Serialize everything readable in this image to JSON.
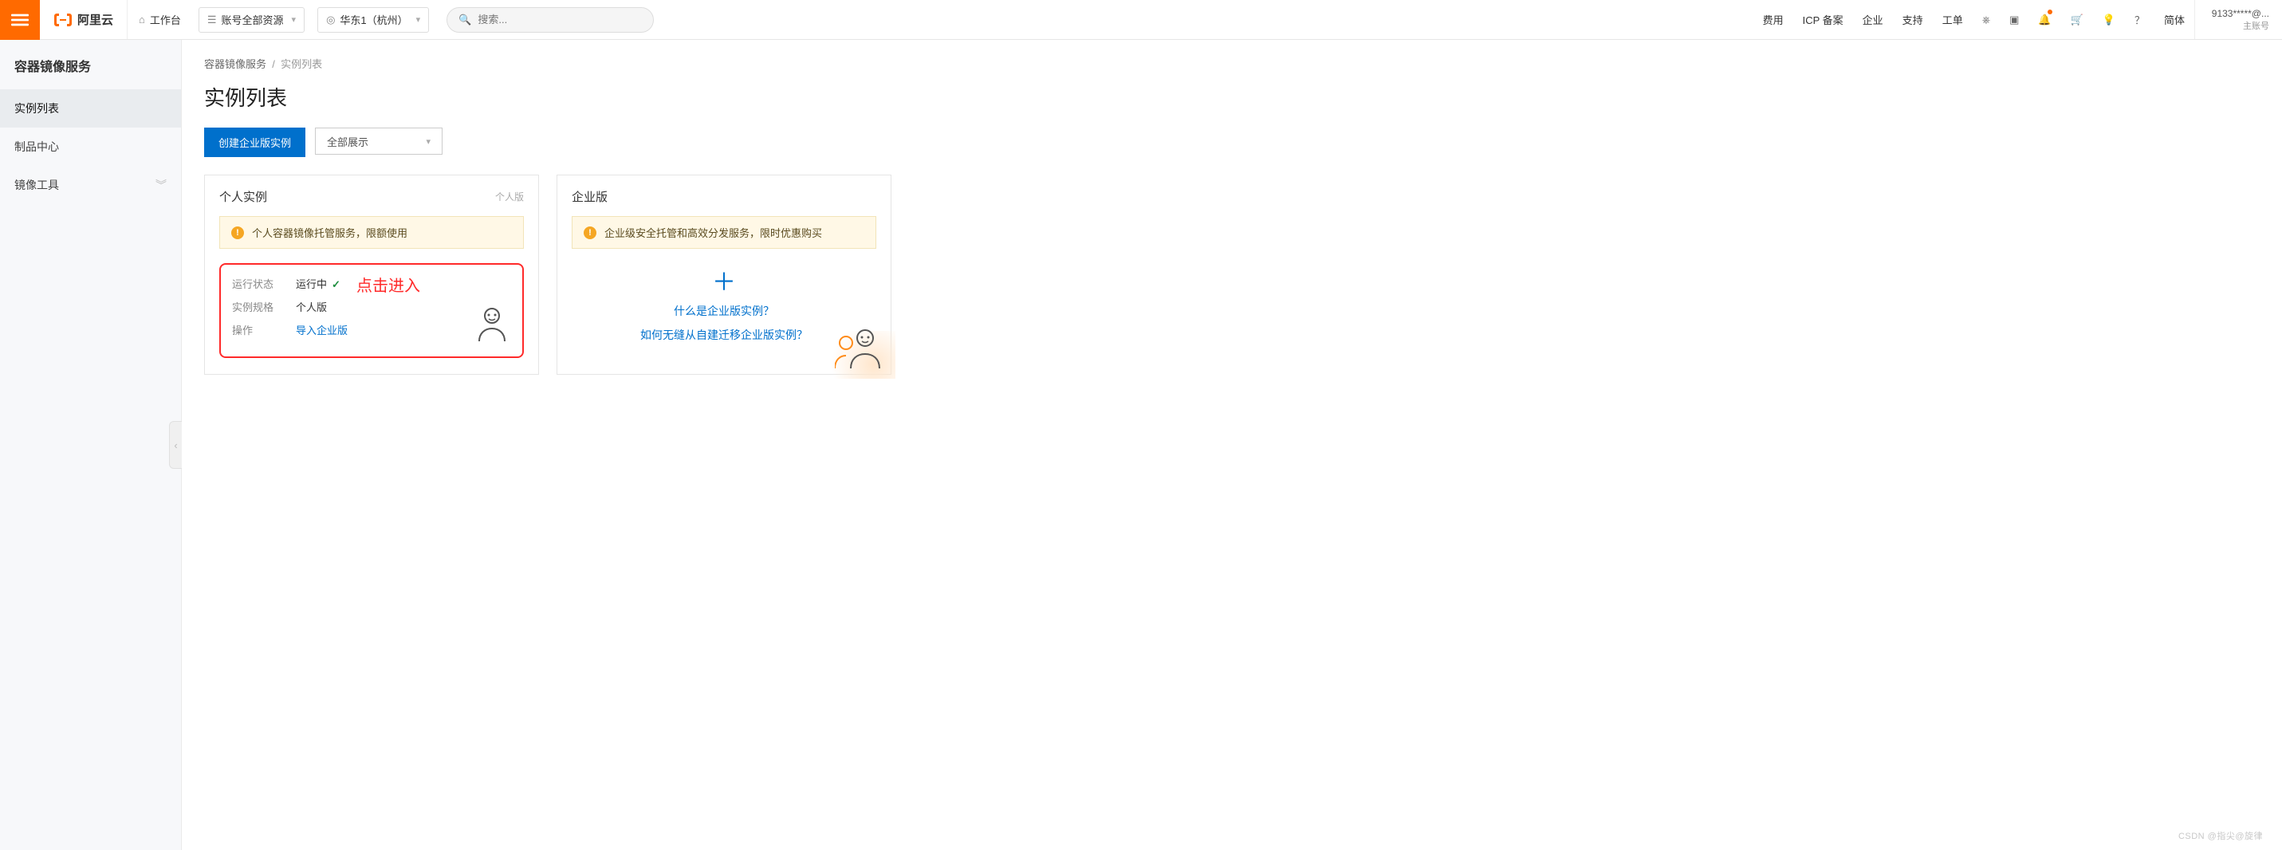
{
  "header": {
    "brand": "阿里云",
    "workspace": "工作台",
    "resource_selector": "账号全部资源",
    "region_selector": "华东1（杭州）",
    "search_placeholder": "搜索...",
    "nav": {
      "fee": "费用",
      "icp": "ICP 备案",
      "enterprise": "企业",
      "support": "支持",
      "ticket": "工单"
    },
    "lang": "简体",
    "account_masked": "9133*****@...",
    "account_type": "主账号"
  },
  "sidebar": {
    "title": "容器镜像服务",
    "items": [
      {
        "label": "实例列表",
        "active": true
      },
      {
        "label": "制品中心",
        "active": false
      },
      {
        "label": "镜像工具",
        "active": false,
        "expandable": true
      }
    ]
  },
  "main": {
    "breadcrumbs": {
      "root": "容器镜像服务",
      "current": "实例列表"
    },
    "title": "实例列表",
    "toolbar": {
      "create_btn": "创建企业版实例",
      "filter_select": "全部展示"
    },
    "cards": {
      "personal": {
        "title": "个人实例",
        "tag": "个人版",
        "banner": "个人容器镜像托管服务，限额使用",
        "rows": {
          "status_label": "运行状态",
          "status_value": "运行中",
          "spec_label": "实例规格",
          "spec_value": "个人版",
          "action_label": "操作",
          "action_link": "导入企业版"
        },
        "annotation": "点击进入"
      },
      "enterprise": {
        "title": "企业版",
        "banner": "企业级安全托管和高效分发服务，限时优惠购买",
        "q1": "什么是企业版实例？",
        "q2": "如何无缝从自建迁移企业版实例？"
      }
    }
  },
  "watermark": "CSDN @指尖@旋律"
}
